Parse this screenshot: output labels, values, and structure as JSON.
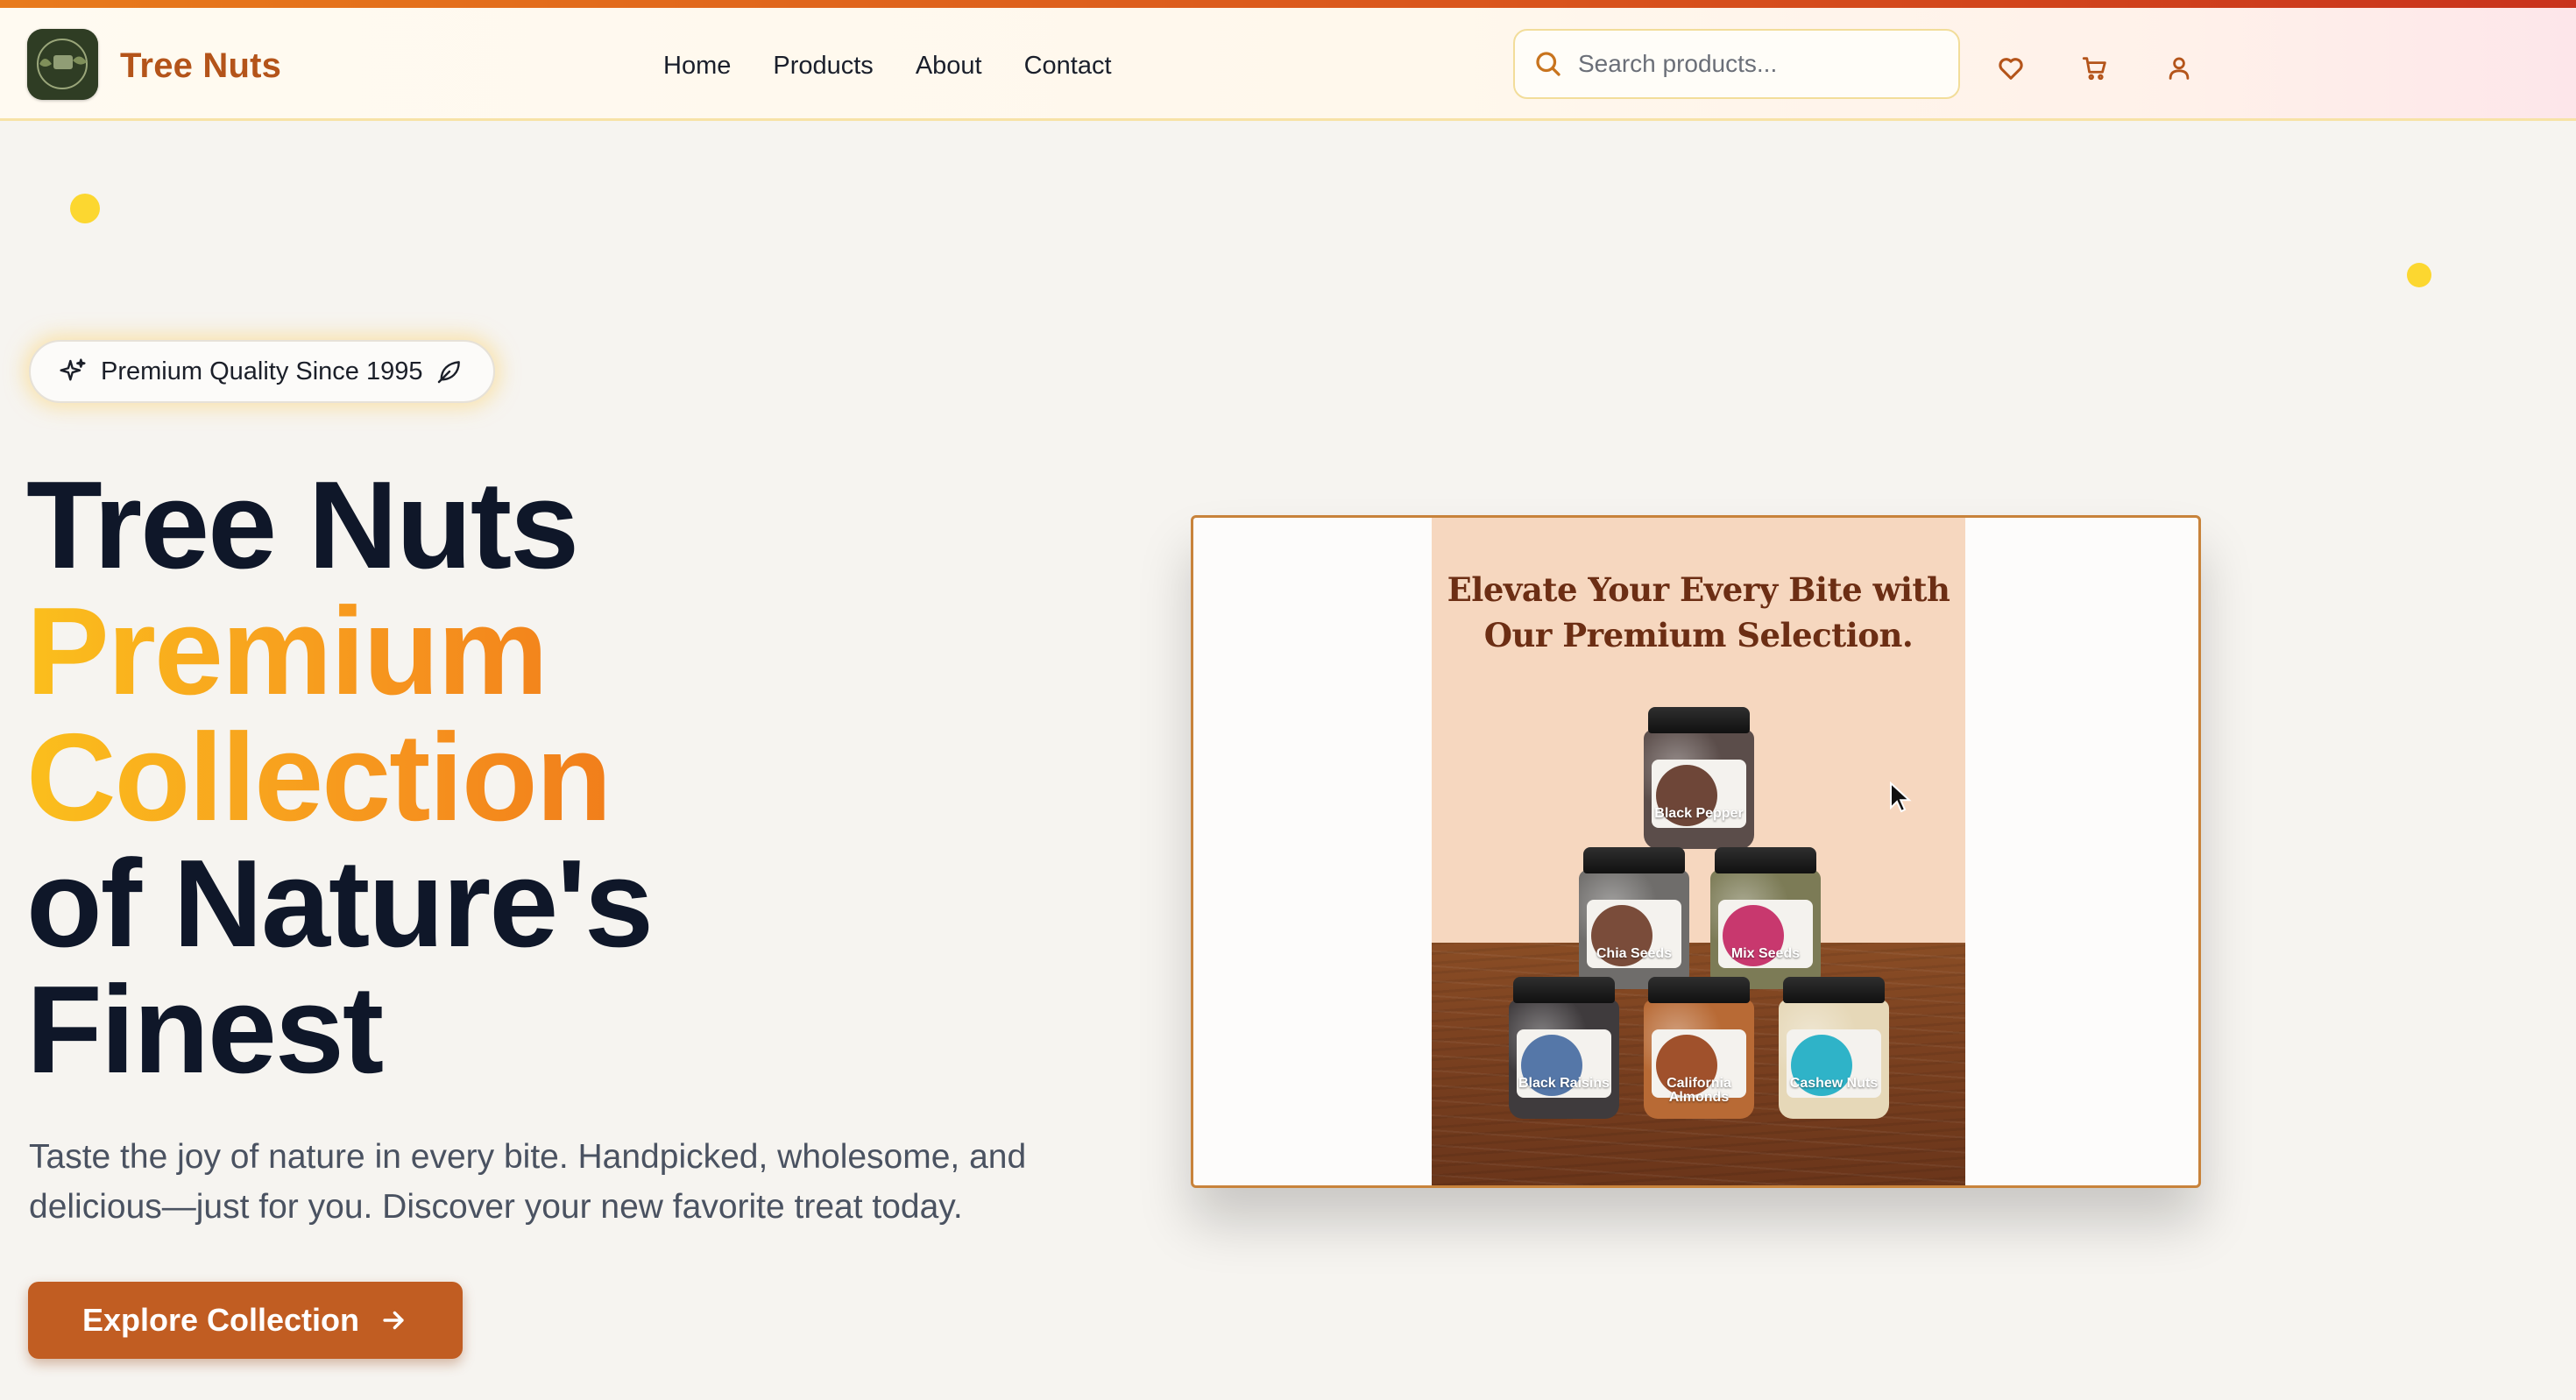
{
  "header": {
    "brand": "Tree Nuts",
    "logo_alt": "Tree Nuts logo",
    "nav": [
      "Home",
      "Products",
      "About",
      "Contact"
    ],
    "search_placeholder": "Search products...",
    "icons": [
      "heart-icon",
      "cart-icon",
      "user-icon"
    ]
  },
  "hero": {
    "badge": "Premium Quality Since 1995",
    "headline": {
      "line1": "Tree Nuts",
      "line2": "Premium",
      "line3": "Collection",
      "line4": "of Nature's",
      "line5": "Finest"
    },
    "subtext": "Taste the joy of nature in every bite. Handpicked, wholesome, and delicious—just for you. Discover your new favorite treat today.",
    "cta": "Explore Collection"
  },
  "promo": {
    "title_line1": "Elevate Your Every Bite with",
    "title_line2": "Our Premium Selection.",
    "jars": [
      {
        "name": "Black Pepper"
      },
      {
        "name": "Chia Seeds"
      },
      {
        "name": "Mix Seeds"
      },
      {
        "name": "Black Raisins"
      },
      {
        "name": "California Almonds"
      },
      {
        "name": "Cashew Nuts"
      }
    ]
  },
  "colors": {
    "brand": "#b4541a",
    "accent_gradient_start": "#fbbf1d",
    "accent_gradient_end": "#f07a1a",
    "cta": "#c15d22",
    "heading": "#0f1729",
    "body_text": "#4a5261"
  }
}
